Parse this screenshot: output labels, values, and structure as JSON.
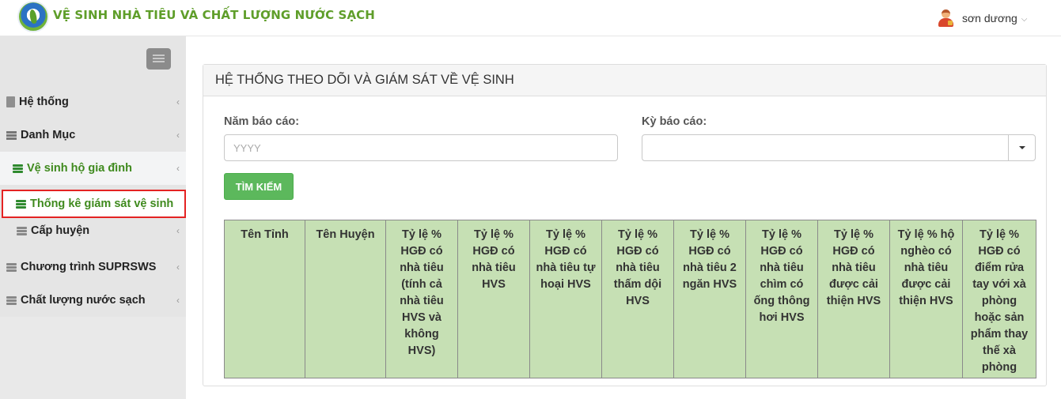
{
  "header": {
    "title": "VỆ SINH NHÀ TIÊU VÀ CHẤT LƯỢNG NƯỚC SẠCH",
    "user_name": "sơn dương",
    "user_chevron": "⌵"
  },
  "sidebar": {
    "items": [
      {
        "label": "Hệ thống",
        "icon": "document-icon"
      },
      {
        "label": "Danh Mục",
        "icon": "list-icon"
      },
      {
        "label": "Vệ sinh hộ gia đình",
        "icon": "server-icon"
      },
      {
        "label": "Thống kê giám sát vệ sinh",
        "icon": "server-icon"
      },
      {
        "label": "Cấp huyện",
        "icon": "server-icon"
      },
      {
        "label": "Chương trình SUPRSWS",
        "icon": "server-icon"
      },
      {
        "label": "Chất lượng nước sạch",
        "icon": "server-icon"
      }
    ]
  },
  "panel": {
    "title": "HỆ THỐNG THEO DÕI VÀ GIÁM SÁT VỀ VỆ SINH",
    "year_label": "Năm báo cáo:",
    "year_placeholder": "YYYY",
    "period_label": "Kỳ báo cáo:",
    "period_value": "",
    "search_button": "TÌM KIẾM"
  },
  "table": {
    "columns": [
      "Tên Tỉnh",
      "Tên Huyện",
      "Tỷ lệ % HGĐ có nhà tiêu (tính cả nhà tiêu HVS và không HVS)",
      "Tỷ lệ % HGĐ có nhà tiêu HVS",
      "Tỷ lệ % HGĐ có nhà tiêu tự hoại HVS",
      "Tỷ lệ % HGĐ có nhà tiêu thấm dội HVS",
      "Tỷ lệ % HGĐ có nhà tiêu 2 ngăn HVS",
      "Tỷ lệ % HGĐ có nhà tiêu chìm có ống thông hơi HVS",
      "Tỷ lệ % HGĐ có nhà tiêu được cải thiện HVS",
      "Tỷ lệ % hộ nghèo có nhà tiêu được cải thiện HVS",
      "Tỷ lệ % HGĐ có điểm rửa tay với xà phòng hoặc sản phẩm thay thế xà phòng"
    ],
    "header_color": "#c6e0b4"
  },
  "colors": {
    "brand_green": "#5f9e2a",
    "active_green": "#3f8a1e",
    "button_green": "#5cb85c",
    "selection_red": "#e42323"
  }
}
